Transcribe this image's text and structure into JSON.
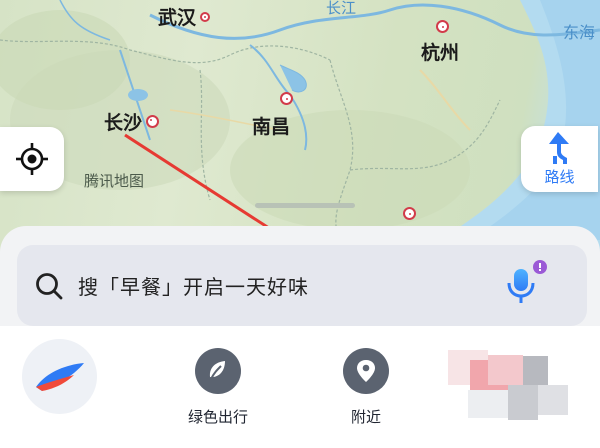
{
  "map": {
    "cities": {
      "wuhan": "武汉",
      "hangzhou": "杭州",
      "changsha": "长沙",
      "nanchang": "南昌"
    },
    "water_labels": {
      "changjiang": "长江",
      "donghai": "东海"
    },
    "watermark": "腾讯地图"
  },
  "controls": {
    "locate_icon": "locate-target-icon",
    "route_label": "路线",
    "route_icon": "route-arrow-icon"
  },
  "search": {
    "placeholder": "搜「早餐」开启一天好味",
    "search_icon": "search-icon",
    "mic_icon": "voice-mic-icon"
  },
  "bottom_nav": {
    "items": [
      {
        "label": "绿色出行",
        "icon": "leaf-icon"
      },
      {
        "label": "附近",
        "icon": "location-pin-icon"
      }
    ]
  },
  "colors": {
    "accent_blue": "#2f7bf5",
    "city_dot": "#d23b4a",
    "annotation_arrow": "#e63a32",
    "nav_icon_bg": "#5b6370"
  }
}
